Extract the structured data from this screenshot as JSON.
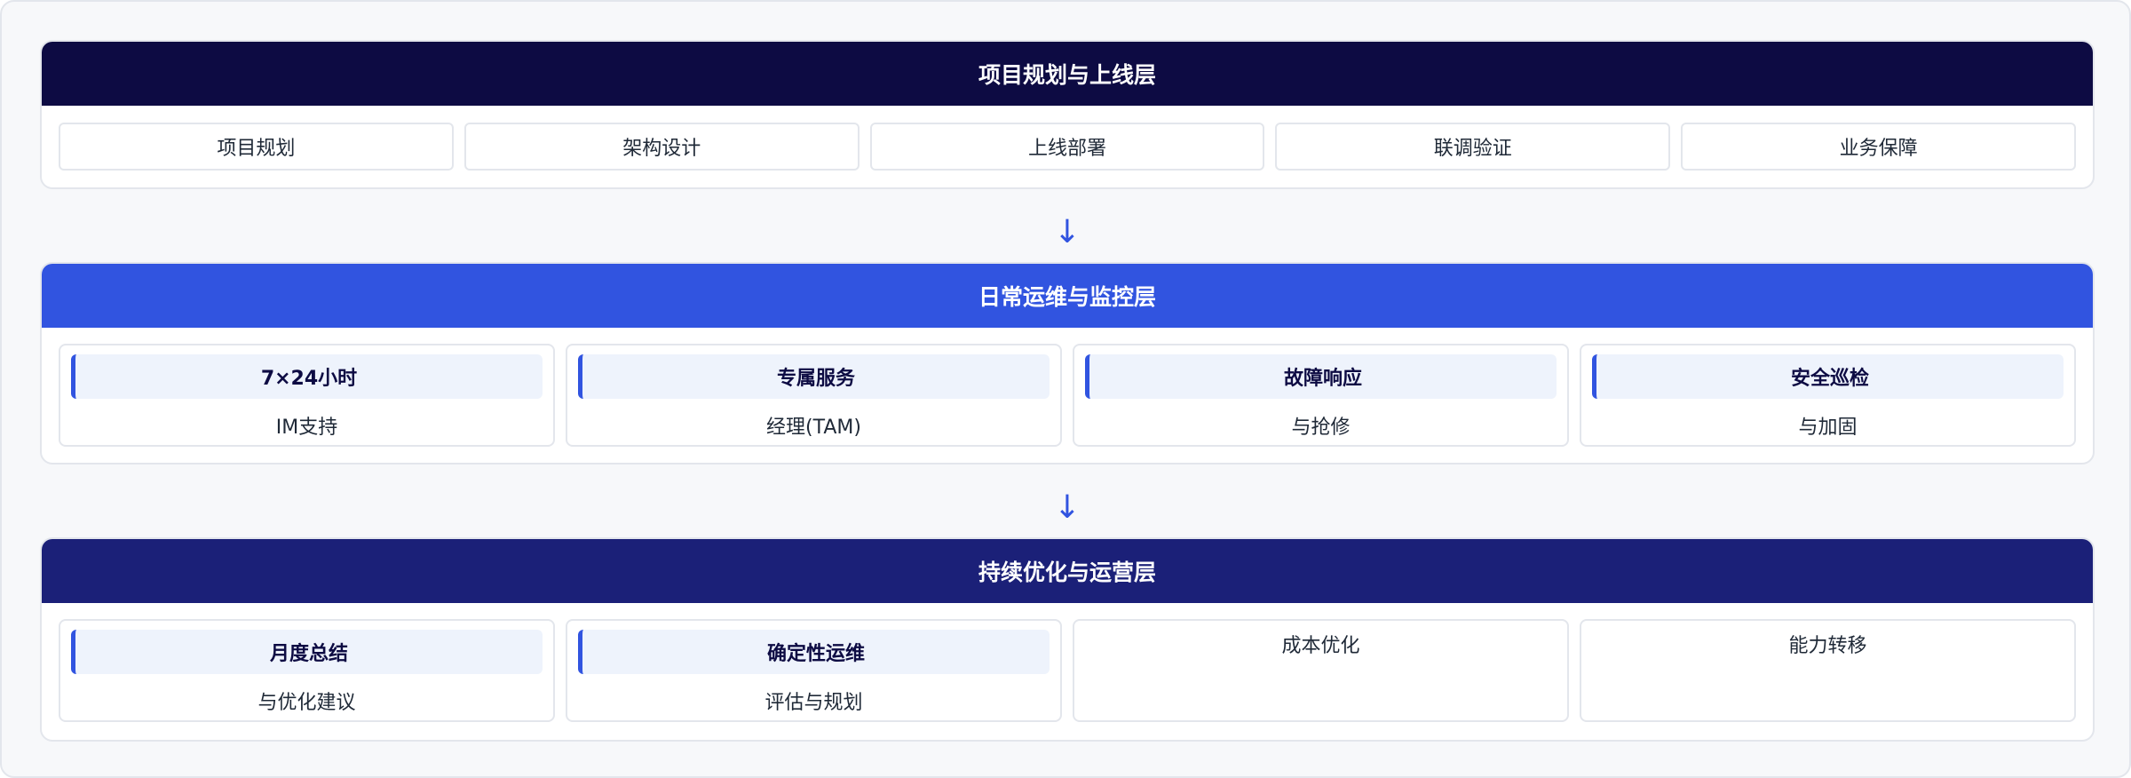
{
  "layers": [
    {
      "title": "项目规划与上线层",
      "items": [
        "项目规划",
        "架构设计",
        "上线部署",
        "联调验证",
        "业务保障"
      ]
    },
    {
      "title": "日常运维与监控层",
      "cards": [
        {
          "title": "7×24小时",
          "sub": "IM支持"
        },
        {
          "title": "专属服务",
          "sub": "经理(TAM)"
        },
        {
          "title": "故障响应",
          "sub": "与抢修"
        },
        {
          "title": "安全巡检",
          "sub": "与加固"
        }
      ]
    },
    {
      "title": "持续优化与运营层",
      "cards": [
        {
          "title": "月度总结",
          "sub": "与优化建议"
        },
        {
          "title": "确定性运维",
          "sub": "评估与规划"
        },
        {
          "label": "成本优化"
        },
        {
          "label": "能力转移"
        }
      ]
    }
  ],
  "arrow_glyph": "↓",
  "colors": {
    "layer1_header": "#0d0b43",
    "layer2_header": "#3154e0",
    "layer3_header": "#1b2078",
    "accent": "#3154e0",
    "card_title_bg": "#eef3fc"
  }
}
